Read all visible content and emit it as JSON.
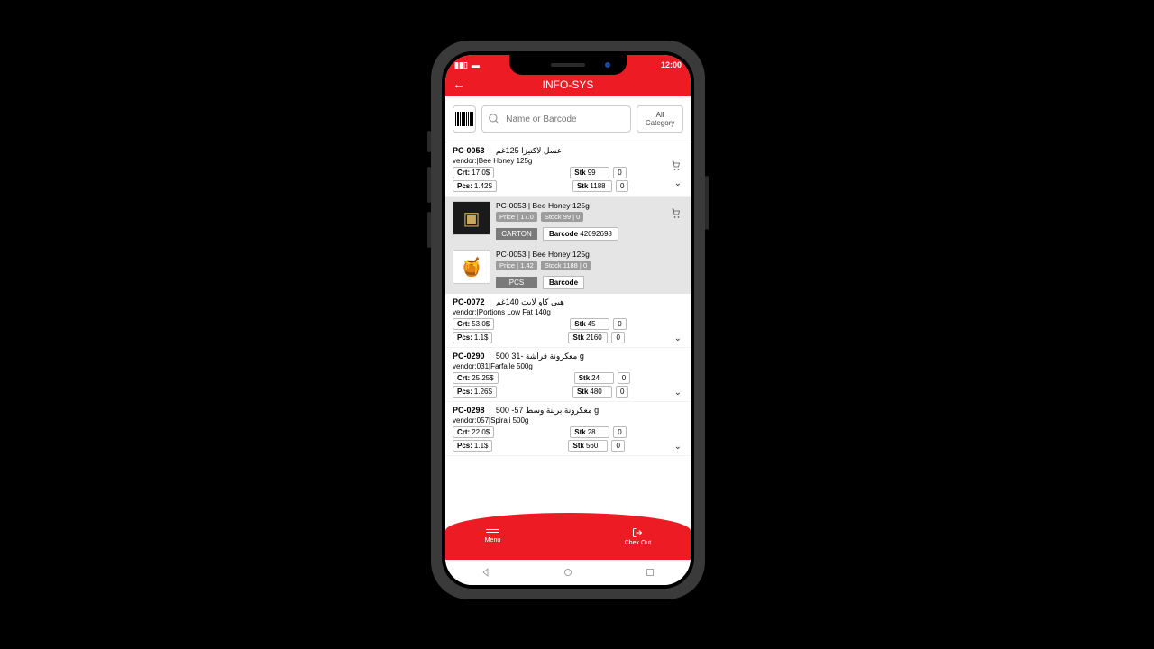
{
  "status": {
    "time": "12:00"
  },
  "header": {
    "title": "INFO-SYS"
  },
  "search": {
    "placeholder": "Name or Barcode",
    "category_label": "All Category"
  },
  "products": [
    {
      "code": "PC-0053",
      "name_ar": "عسل لاكتيزا 125غم",
      "vendor": "vendor:|Bee Honey 125g",
      "crt_label": "Crt:",
      "crt_price": "17.0$",
      "pcs_label": "Pcs:",
      "pcs_price": "1.42$",
      "stk1_label": "Stk",
      "stk1": "99",
      "qty1": "0",
      "stk2_label": "Stk",
      "stk2": "1188",
      "qty2": "0",
      "expanded": [
        {
          "title": "PC-0053  |  Bee Honey 125g",
          "price_label": "Price",
          "price": "17.0",
          "stock_label": "Stock",
          "stock": "99",
          "qty": "0",
          "unit": "CARTON",
          "barcode_label": "Barcode",
          "barcode": "42092698"
        },
        {
          "title": "PC-0053  |  Bee Honey 125g",
          "price_label": "Price",
          "price": "1.42",
          "stock_label": "Stock",
          "stock": "1188",
          "qty": "0",
          "unit": "PCS",
          "barcode_label": "Barcode",
          "barcode": ""
        }
      ]
    },
    {
      "code": "PC-0072",
      "name_ar": "هبي كاو لايت 140غم",
      "vendor": "vendor:|Portions Low Fat 140g",
      "crt_label": "Crt:",
      "crt_price": "53.0$",
      "pcs_label": "Pcs:",
      "pcs_price": "1.1$",
      "stk1_label": "Stk",
      "stk1": "45",
      "qty1": "0",
      "stk2_label": "Stk",
      "stk2": "2160",
      "qty2": "0"
    },
    {
      "code": "PC-0290",
      "name_ar": "معكرونة فراشة -31 500 g",
      "vendor": "vendor:031|Farfalle  500g",
      "crt_label": "Crt:",
      "crt_price": "25.25$",
      "pcs_label": "Pcs:",
      "pcs_price": "1.26$",
      "stk1_label": "Stk",
      "stk1": "24",
      "qty1": "0",
      "stk2_label": "Stk",
      "stk2": "480",
      "qty2": "0"
    },
    {
      "code": "PC-0298",
      "name_ar": "معكرونة برينة وسط 57- 500 g",
      "vendor": "vendor:057|Spirali 500g",
      "crt_label": "Crt:",
      "crt_price": "22.0$",
      "pcs_label": "Pcs:",
      "pcs_price": "1.1$",
      "stk1_label": "Stk",
      "stk1": "28",
      "qty1": "0",
      "stk2_label": "Stk",
      "stk2": "560",
      "qty2": "0"
    }
  ],
  "nav": {
    "menu": "Menu",
    "checkout": "Chek Out"
  }
}
